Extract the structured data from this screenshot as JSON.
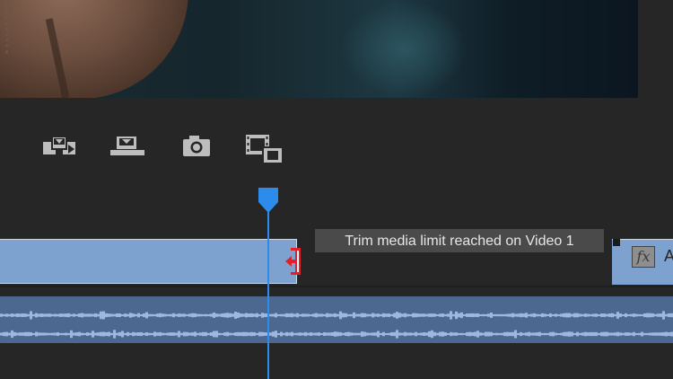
{
  "tooltip": {
    "text": "Trim media limit reached on Video 1"
  },
  "clip_right": {
    "fx_label": "fx",
    "label_start": "A"
  },
  "toolbar": {
    "buttons": [
      {
        "name": "insert-icon"
      },
      {
        "name": "overwrite-icon"
      },
      {
        "name": "export-frame-icon"
      },
      {
        "name": "compare-view-icon"
      }
    ]
  },
  "colors": {
    "playhead": "#2d8ceb",
    "video_clip": "#7ea2cf",
    "audio_track": "#4c6891",
    "trim_cursor": "#e0202a",
    "panel_bg": "#262626"
  }
}
